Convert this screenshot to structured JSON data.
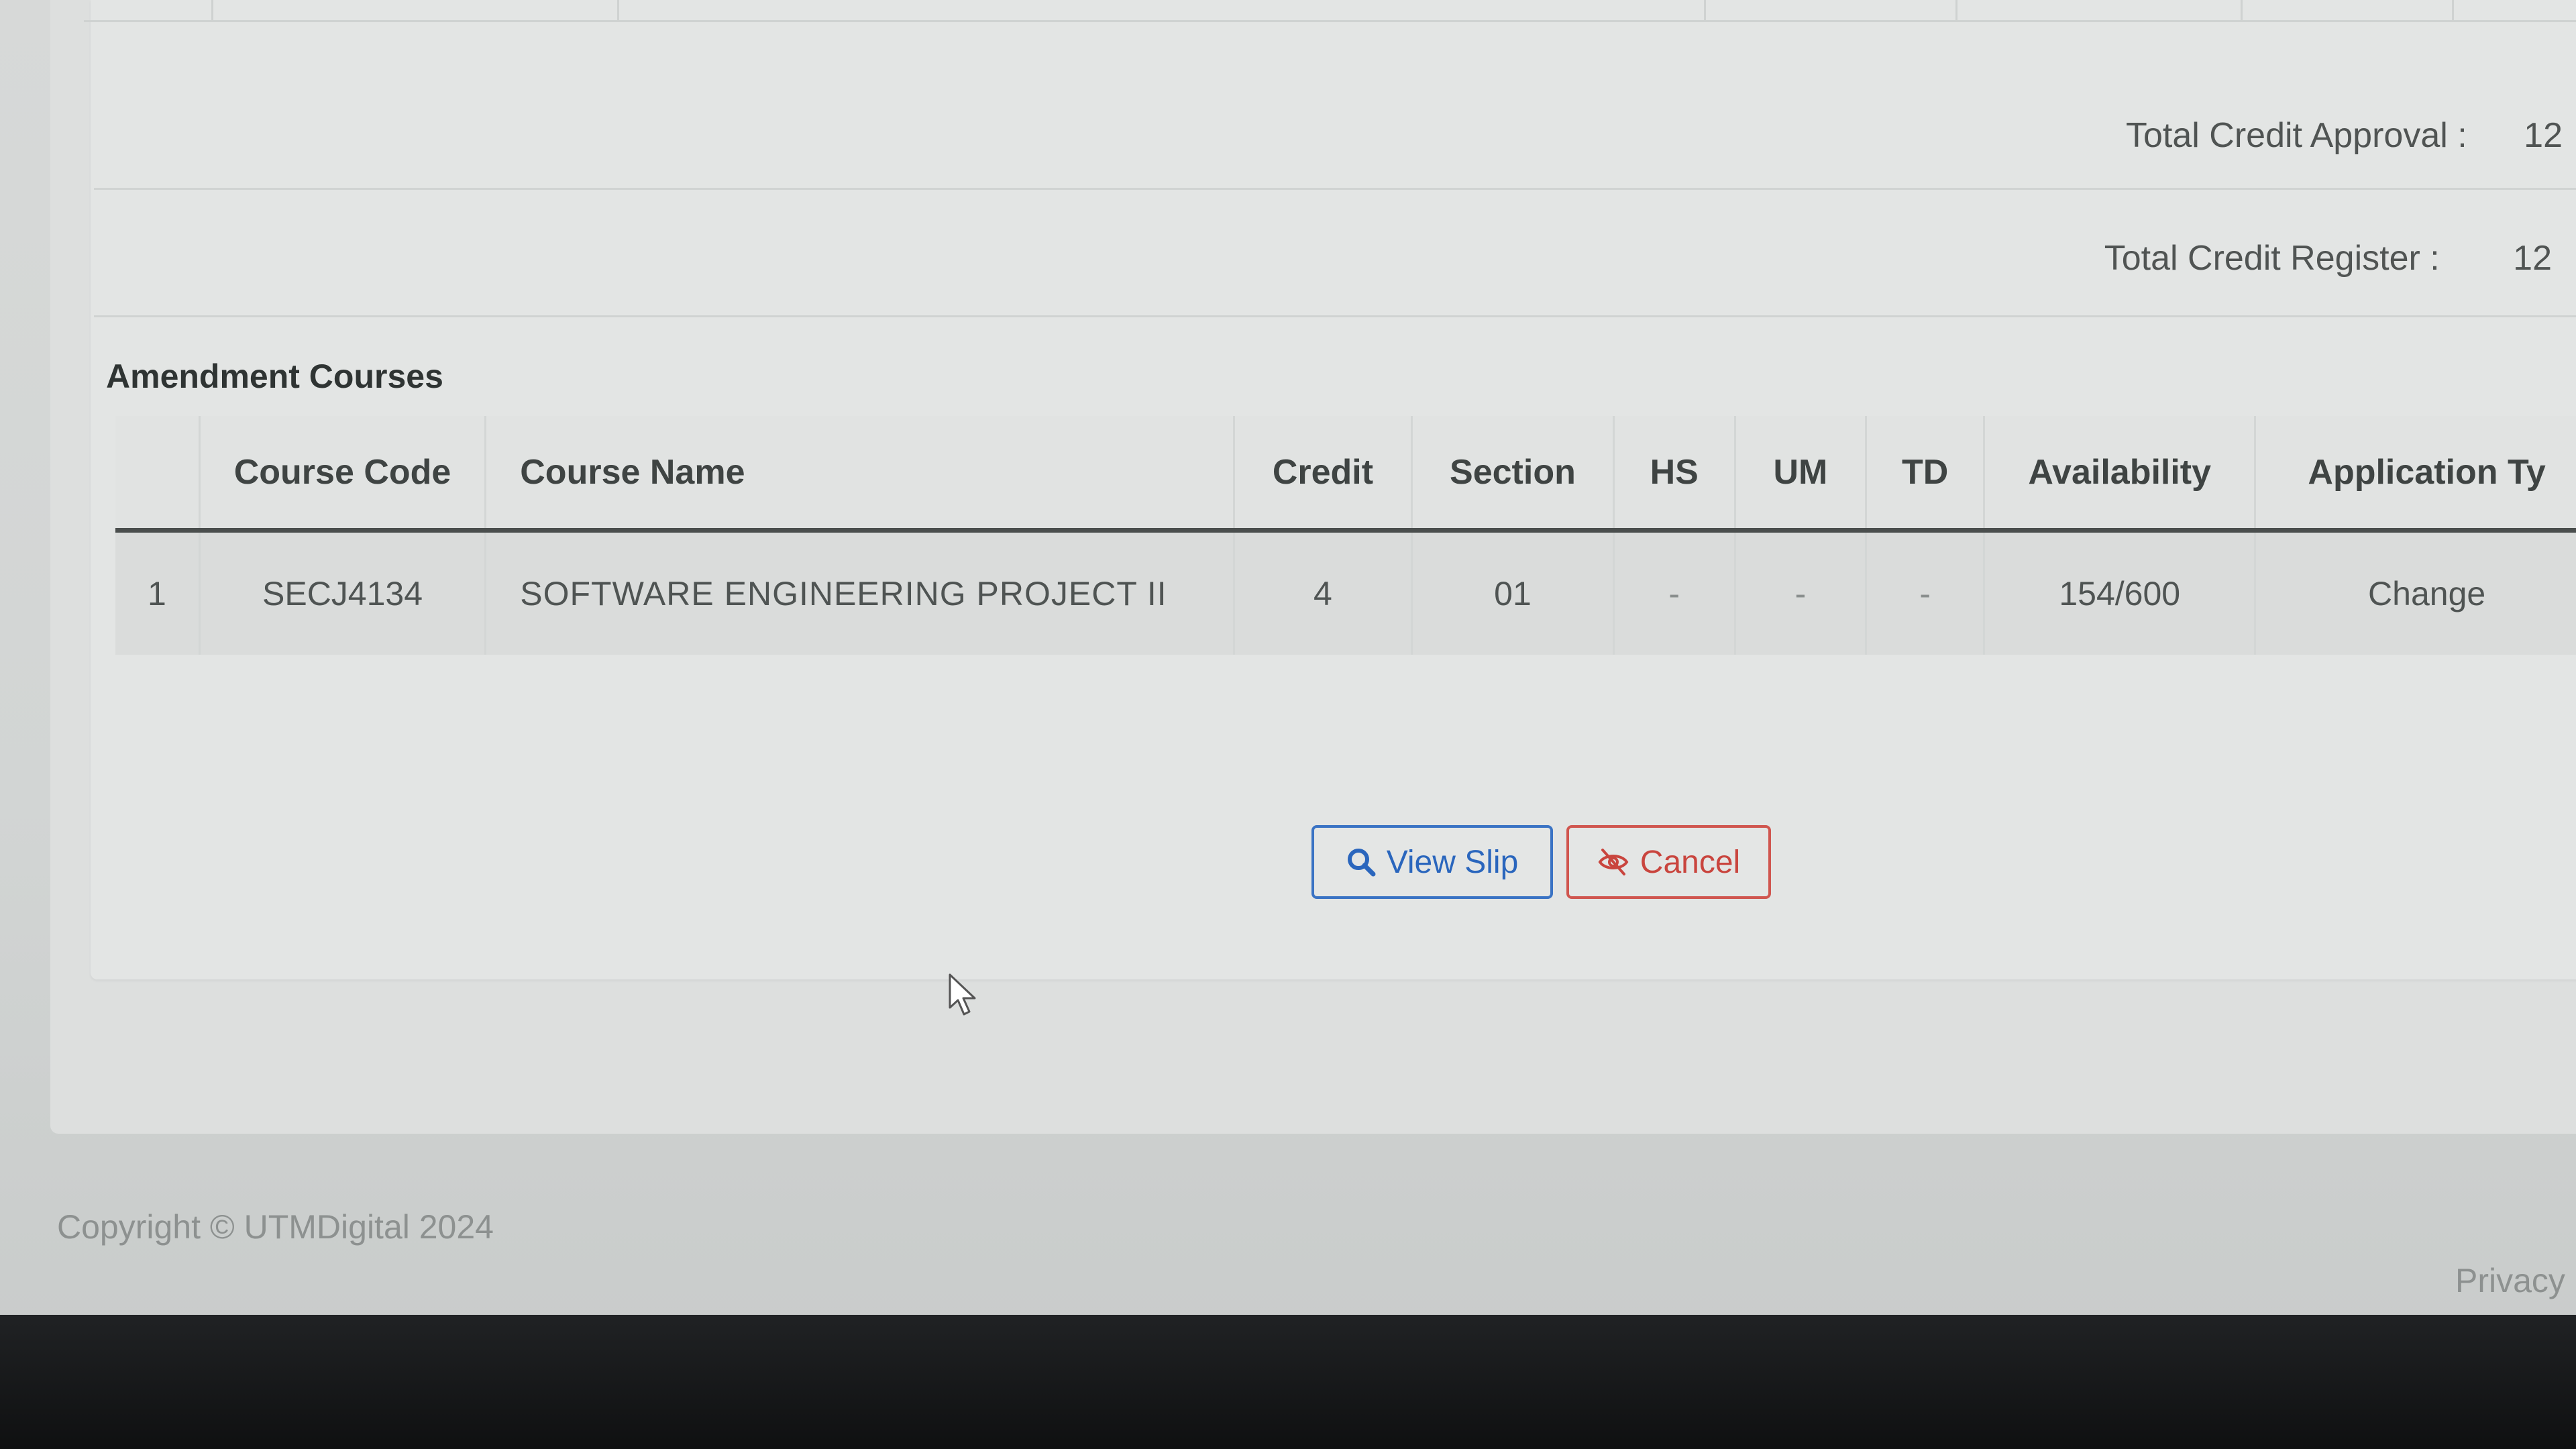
{
  "credits": {
    "approval_label": "Total Credit Approval :",
    "approval_value": "12",
    "register_label": "Total Credit Register :",
    "register_value": "12"
  },
  "amendment": {
    "title": "Amendment Courses",
    "columns": [
      "",
      "Course Code",
      "Course Name",
      "Credit",
      "Section",
      "HS",
      "UM",
      "TD",
      "Availability",
      "Application Ty"
    ],
    "rows": [
      {
        "no": "1",
        "code": "SECJ4134",
        "name": "SOFTWARE ENGINEERING PROJECT II",
        "credit": "4",
        "section": "01",
        "hs": "-",
        "um": "-",
        "td": "-",
        "availability": "154/600",
        "application_type": "Change"
      }
    ]
  },
  "actions": {
    "view_slip_label": "View Slip",
    "cancel_label": "Cancel",
    "view_icon": "search-icon",
    "cancel_icon": "eye-slash-icon"
  },
  "footer": {
    "copyright": "Copyright © UTMDigital 2024",
    "privacy": "Privacy"
  },
  "colors": {
    "primary": "#2a66bd",
    "danger": "#c9453e"
  }
}
